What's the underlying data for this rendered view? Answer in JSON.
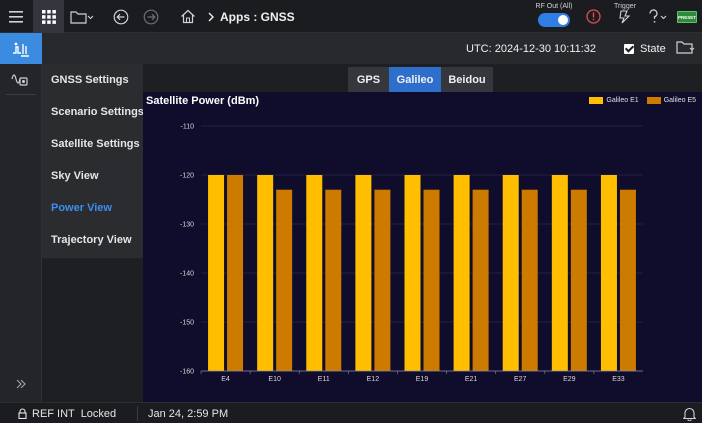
{
  "toolbar": {
    "breadcrumb": "Apps : GNSS",
    "rf_out_label": "RF Out (All)",
    "rf_out_on": true,
    "trigger_label": "Trigger",
    "preset_label": "PRESET",
    "icons": [
      "menu-icon",
      "apps-grid-icon",
      "folder-icon",
      "back-icon",
      "forward-icon",
      "home-icon",
      "alert-icon",
      "trigger-icon",
      "help-icon"
    ]
  },
  "subbar": {
    "utc": "UTC: 2024-12-30 10:11:32",
    "state_label": "State",
    "state_checked": true
  },
  "menu": {
    "items": [
      {
        "label": "GNSS Settings"
      },
      {
        "label": "Scenario Settings"
      },
      {
        "label": "Satellite Settings"
      },
      {
        "label": "Sky View"
      },
      {
        "label": "Power View"
      },
      {
        "label": "Trajectory View"
      }
    ],
    "selected_index": 4
  },
  "tabs": [
    {
      "label": "GPS"
    },
    {
      "label": "Galileo"
    },
    {
      "label": "Beidou"
    }
  ],
  "active_tab": 1,
  "chart_data": {
    "type": "bar",
    "title": "Satellite Power (dBm)",
    "xlabel": "",
    "ylabel": "",
    "categories": [
      "E4",
      "E10",
      "E11",
      "E12",
      "E19",
      "E21",
      "E27",
      "E29",
      "E33"
    ],
    "series": [
      {
        "name": "Galileo E1",
        "color": "#FFBF00",
        "values": [
          -120,
          -120,
          -120,
          -120,
          -120,
          -120,
          -120,
          -120,
          -120
        ]
      },
      {
        "name": "Galileo E5",
        "color": "#CC7A00",
        "values": [
          -120,
          -123,
          -123,
          -123,
          -123,
          -123,
          -123,
          -123,
          -123
        ]
      }
    ],
    "ylim": [
      -160,
      -110
    ],
    "yticks": [
      -110,
      -120,
      -130,
      -140,
      -150,
      -160
    ],
    "grid": true,
    "legend_position": "top-right"
  },
  "statusbar": {
    "ref": "REF INT  Locked",
    "datetime": "Jan 24, 2:59 PM"
  },
  "colors": {
    "accent": "#3b8be0",
    "chart_bg": "#0f0c2c",
    "selected_menu": "#3d8ef0"
  }
}
